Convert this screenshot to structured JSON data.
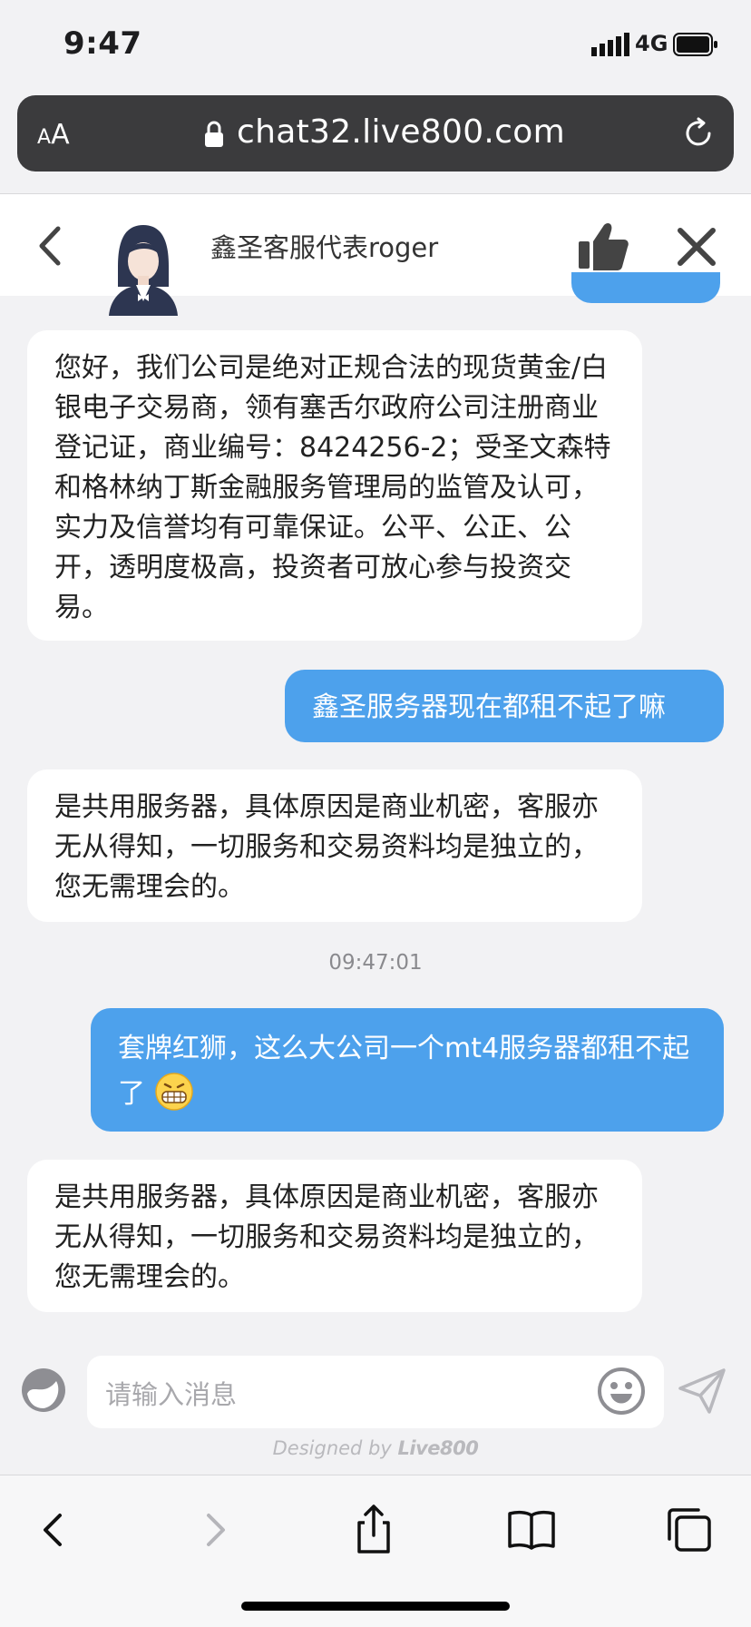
{
  "status_bar": {
    "time": "9:47",
    "network": "4G"
  },
  "browser": {
    "aa_small": "A",
    "aa_big": "A",
    "url": "chat32.live800.com"
  },
  "chat_header": {
    "agent_name": "鑫圣客服代表roger"
  },
  "messages": [
    {
      "sender": "agent",
      "text": "您好，我们公司是绝对正规合法的现货黄金/白银电子交易商，领有塞舌尔政府公司注册商业登记证，商业编号：8424256-2；受圣文森特和格林纳丁斯金融服务管理局的监管及认可，实力及信誉均有可靠保证。公平、公正、公开，透明度极高，投资者可放心参与投资交易。"
    },
    {
      "sender": "user",
      "text": "鑫圣服务器现在都租不起了嘛"
    },
    {
      "sender": "agent",
      "text": "是共用服务器，具体原因是商业机密，客服亦无从得知，一切服务和交易资料均是独立的，您无需理会的。"
    },
    {
      "sender": "user",
      "text": "套牌红狮，这么大公司一个mt4服务器都租不起了",
      "emoji": "grimace-emoji"
    },
    {
      "sender": "agent",
      "text": "是共用服务器，具体原因是商业机密，客服亦无从得知，一切服务和交易资料均是独立的，您无需理会的。"
    }
  ],
  "timestamp": "09:47:01",
  "input": {
    "placeholder": "请输入消息"
  },
  "footer": {
    "designed_by": "Designed by",
    "brand": "Live800"
  },
  "colors": {
    "user_bubble": "#4da1ec",
    "agent_bubble": "#ffffff",
    "background": "#f2f2f4"
  },
  "icons": [
    "back-icon",
    "thumbs-up-icon",
    "close-icon",
    "lock-icon",
    "reload-icon",
    "send-icon",
    "emoji-icon",
    "share-icon",
    "bookmarks-icon",
    "tabs-icon"
  ]
}
